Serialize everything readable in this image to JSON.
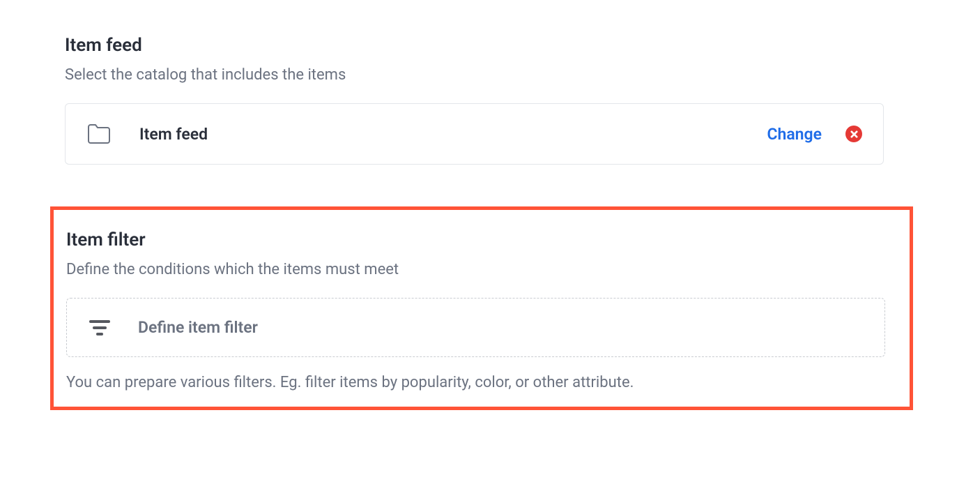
{
  "item_feed": {
    "title": "Item feed",
    "subtitle": "Select the catalog that includes the items",
    "selected_name": "Item feed",
    "change_label": "Change"
  },
  "item_filter": {
    "title": "Item filter",
    "subtitle": "Define the conditions which the items must meet",
    "define_label": "Define item filter",
    "hint": "You can prepare various filters. Eg. filter items by popularity, color, or other attribute."
  }
}
